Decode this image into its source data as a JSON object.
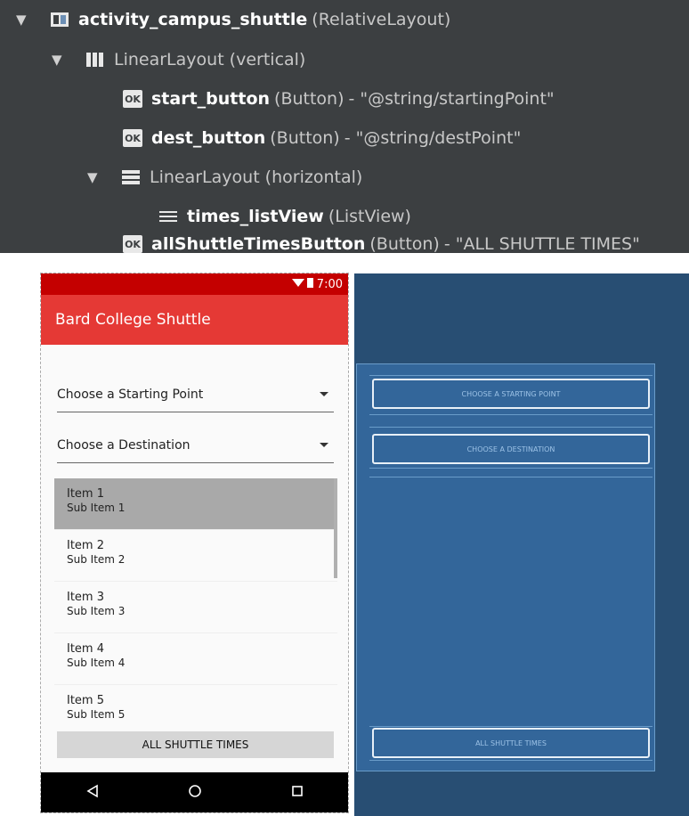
{
  "tree": [
    {
      "indent": 0,
      "arrow": "▼",
      "icon": "relative-layout-icon",
      "name": "activity_campus_shuttle",
      "type": "(RelativeLayout)",
      "value": ""
    },
    {
      "indent": 1,
      "arrow": "▼",
      "icon": "vertical-linear-layout-icon",
      "name": "",
      "type": "LinearLayout (vertical)",
      "value": ""
    },
    {
      "indent": 2,
      "arrow": "",
      "icon": "button-icon",
      "name": "start_button",
      "type": "(Button)",
      "value": "- \"@string/startingPoint\""
    },
    {
      "indent": 2,
      "arrow": "",
      "icon": "button-icon",
      "name": "dest_button",
      "type": "(Button)",
      "value": "- \"@string/destPoint\""
    },
    {
      "indent": 2,
      "arrow": "▼",
      "icon": "horizontal-linear-layout-icon",
      "name": "",
      "type": "LinearLayout (horizontal)",
      "value": ""
    },
    {
      "indent": 3,
      "arrow": "",
      "icon": "listview-icon",
      "name": "times_listView",
      "type": "(ListView)",
      "value": ""
    },
    {
      "indent": 2,
      "arrow": "",
      "icon": "button-icon",
      "name": "allShuttleTimesButton",
      "type": "(Button)",
      "value": "- \"ALL SHUTTLE TIMES\""
    }
  ],
  "preview": {
    "status_time": "7:00",
    "app_title": "Bard College Shuttle",
    "spinner_start": "Choose a Starting Point",
    "spinner_dest": "Choose a Destination",
    "list_items": [
      {
        "title": "Item 1",
        "subtitle": "Sub Item 1"
      },
      {
        "title": "Item 2",
        "subtitle": "Sub Item 2"
      },
      {
        "title": "Item 3",
        "subtitle": "Sub Item 3"
      },
      {
        "title": "Item 4",
        "subtitle": "Sub Item 4"
      },
      {
        "title": "Item 5",
        "subtitle": "Sub Item 5"
      }
    ],
    "all_times_button": "ALL SHUTTLE TIMES"
  },
  "blueprint": {
    "start_button": "CHOOSE A STARTING POINT",
    "dest_button": "CHOOSE A DESTINATION",
    "all_button": "ALL SHUTTLE TIMES"
  },
  "colors": {
    "tree_bg": "#3c3f41",
    "status_bar": "#c40000",
    "app_bar": "#e53935",
    "blueprint_bg": "#284e73",
    "blueprint_inner": "#33669a"
  }
}
